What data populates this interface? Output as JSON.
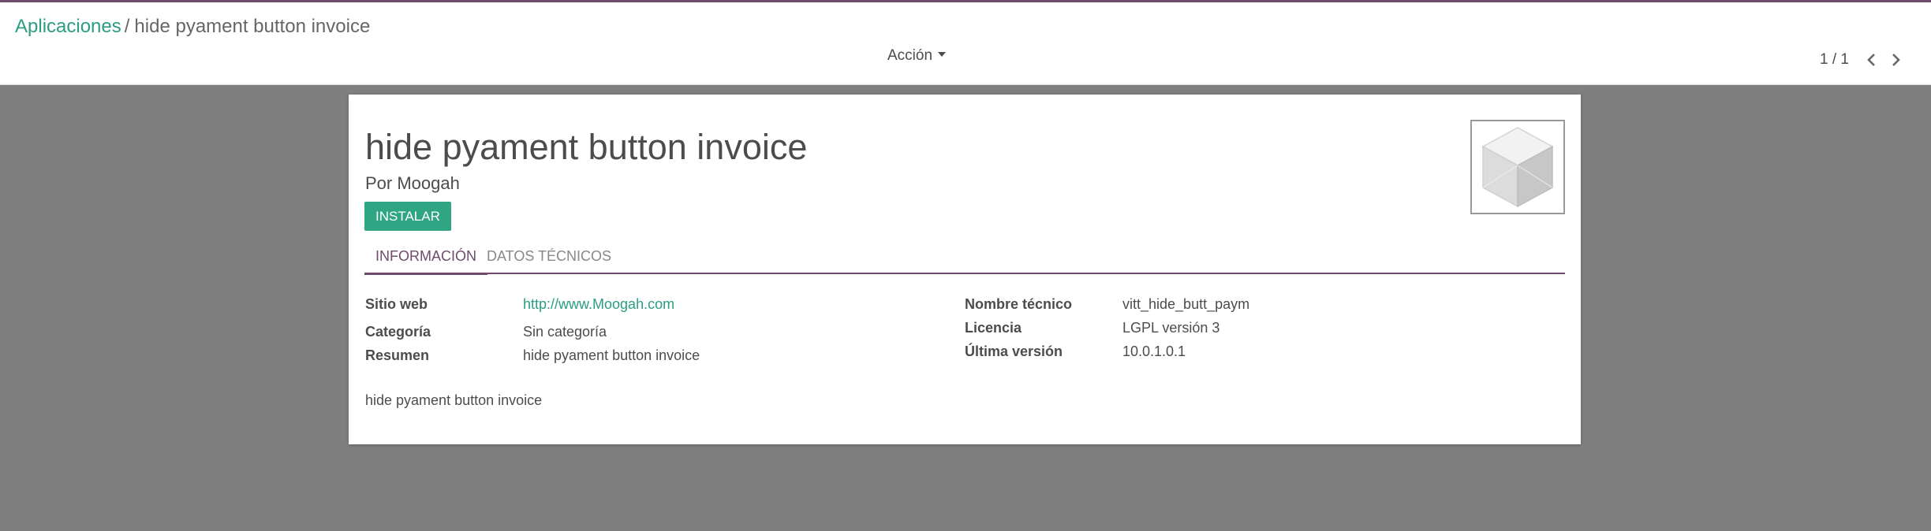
{
  "control_panel": {
    "breadcrumb": {
      "parent": "Aplicaciones",
      "separator": "/",
      "current": "hide pyament button invoice"
    },
    "action_label": "Acción",
    "pager": {
      "value": "1 / 1"
    }
  },
  "module": {
    "title": "hide pyament button invoice",
    "author": "Por Moogah",
    "install_label": "INSTALAR",
    "icon": "cube-icon",
    "tabs": [
      {
        "label": "INFORMACIÓN",
        "active": true
      },
      {
        "label": "DATOS TÉCNICOS",
        "active": false
      }
    ],
    "fields_left": [
      {
        "label": "Sitio web",
        "value": "http://www.Moogah.com"
      },
      {
        "label": "Categoría",
        "value": "Sin categoría"
      },
      {
        "label": "Resumen",
        "value": "hide pyament button invoice"
      }
    ],
    "fields_right": [
      {
        "label": "Nombre técnico",
        "value": "vitt_hide_butt_paym"
      },
      {
        "label": "Licencia",
        "value": "LGPL versión 3"
      },
      {
        "label": "Última versión",
        "value": "10.0.1.0.1"
      }
    ],
    "description": "hide pyament button invoice"
  },
  "colors": {
    "accent": "#2fa584",
    "brand": "#6f4b6b",
    "backdrop": "#7f7f7f"
  }
}
